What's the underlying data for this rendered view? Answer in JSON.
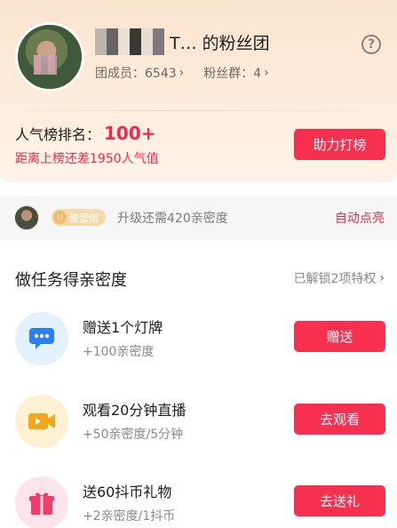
{
  "header": {
    "team_title": "T… 的粉丝团",
    "members_label": "团成员：6543",
    "groups_label": "粉丝群：4",
    "help_glyph": "?"
  },
  "rank": {
    "label": "人气榜排名：",
    "value": "100+",
    "gap_text": "距离上榜还差1950人气值",
    "boost_label": "助力打榜"
  },
  "level": {
    "badge_text": "傻蛋组",
    "badge_glyph": "U",
    "upgrade_text": "升级还需420亲密度",
    "auto_light_label": "自动点亮"
  },
  "tasks_section": {
    "title": "做任务得亲密度",
    "unlock_link": "已解锁2项特权"
  },
  "tasks": [
    {
      "name": "赠送1个灯牌",
      "reward": "+100亲密度",
      "button": "赠送",
      "icon": "chat-bubble-icon",
      "color": "#2b7ff0"
    },
    {
      "name": "观看20分钟直播",
      "reward": "+50亲密度/5分钟",
      "button": "去观看",
      "icon": "video-camera-icon",
      "color": "#f2a71a"
    },
    {
      "name": "送60抖币礼物",
      "reward": "+2亲密度/1抖币",
      "button": "去送礼",
      "icon": "gift-icon",
      "color": "#f03c6e"
    }
  ],
  "colors": {
    "accent": "#f7304f",
    "header_bg": "#fbe3cd"
  }
}
